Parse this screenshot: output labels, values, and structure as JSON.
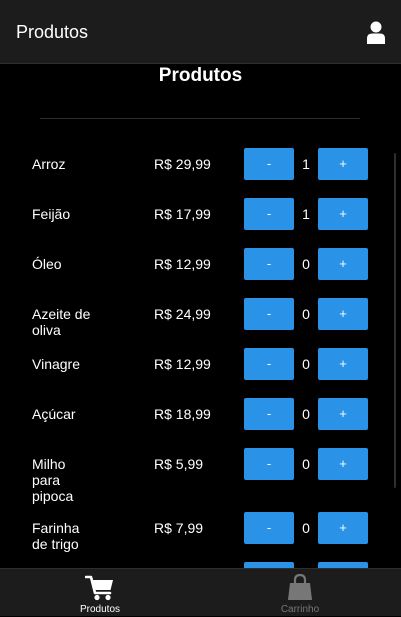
{
  "header": {
    "title": "Produtos",
    "user_icon": "user-icon"
  },
  "page": {
    "title": "Produtos"
  },
  "buttons": {
    "minus_label": "-",
    "plus_label": "+"
  },
  "products": [
    {
      "name": "Arroz",
      "price": "R$ 29,99",
      "quantity": "1"
    },
    {
      "name": "Feijão",
      "price": "R$ 17,99",
      "quantity": "1"
    },
    {
      "name": "Óleo",
      "price": "R$ 12,99",
      "quantity": "0"
    },
    {
      "name": "Azeite de oliva",
      "price": "R$ 24,99",
      "quantity": "0"
    },
    {
      "name": "Vinagre",
      "price": "R$ 12,99",
      "quantity": "0"
    },
    {
      "name": "Açúcar",
      "price": "R$ 18,99",
      "quantity": "0"
    },
    {
      "name": "Milho para pipoca",
      "price": "R$ 5,99",
      "quantity": "0"
    },
    {
      "name": "Farinha de trigo",
      "price": "R$ 7,99",
      "quantity": "0"
    }
  ],
  "bottom_nav": [
    {
      "label": "Produtos",
      "icon": "cart-icon",
      "active": true
    },
    {
      "label": "Carrinho",
      "icon": "shopping-bag-icon",
      "active": false
    }
  ],
  "colors": {
    "background": "#000000",
    "bar": "#1c1c1c",
    "accent": "#2a93e8",
    "inactive": "#777777"
  }
}
